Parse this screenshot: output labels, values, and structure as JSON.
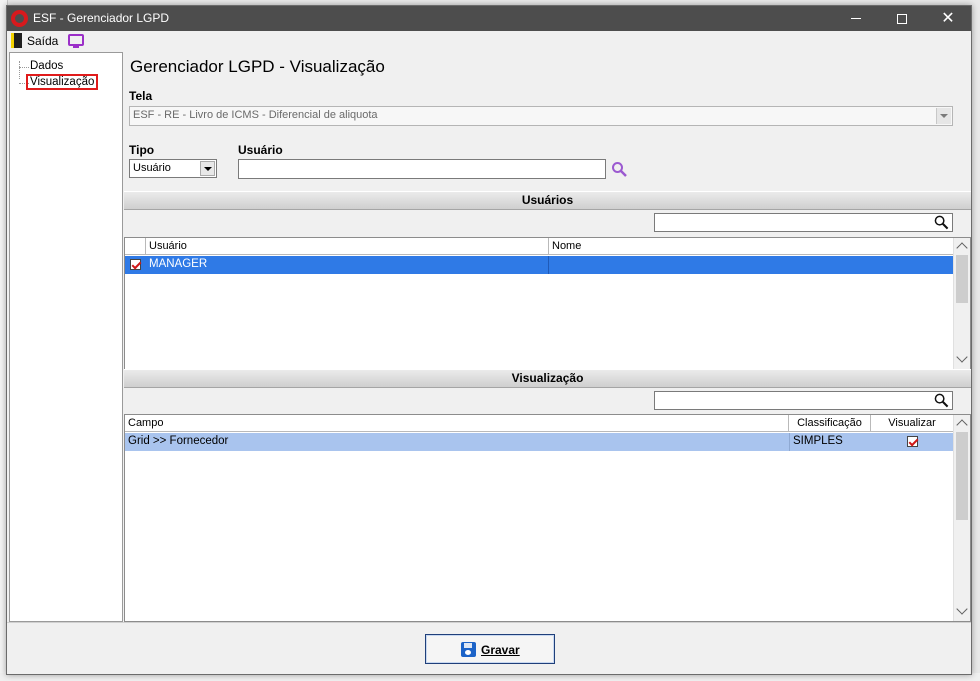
{
  "window": {
    "title": "ESF - Gerenciador LGPD"
  },
  "menu": {
    "exit_label": "Saída"
  },
  "tree": {
    "items": [
      {
        "label": "Dados"
      },
      {
        "label": "Visualização"
      }
    ]
  },
  "page": {
    "title": "Gerenciador LGPD - Visualização"
  },
  "form": {
    "tela_label": "Tela",
    "tela_value": "ESF - RE - Livro de ICMS - Diferencial de aliquota",
    "tipo_label": "Tipo",
    "tipo_value": "Usuário",
    "usuario_label": "Usuário",
    "usuario_value": ""
  },
  "usuarios_section": {
    "title": "Usuários",
    "filter_value": "",
    "columns": [
      "Usuário",
      "Nome"
    ],
    "rows": [
      {
        "checked": true,
        "usuario": "MANAGER",
        "nome": ""
      }
    ]
  },
  "visualizacao_section": {
    "title": "Visualização",
    "filter_value": "",
    "columns": [
      "Campo",
      "Classificação",
      "Visualizar"
    ],
    "rows": [
      {
        "campo": "Grid >> Fornecedor",
        "classificacao": "SIMPLES",
        "visualizar": true
      }
    ]
  },
  "footer": {
    "save_label": "Gravar"
  },
  "colors": {
    "titlebar": "#4d4d4d",
    "selected_row": "#2f7ae6",
    "selected_row_light": "#a9c4ee",
    "tree_highlight": "#e01b1b"
  }
}
